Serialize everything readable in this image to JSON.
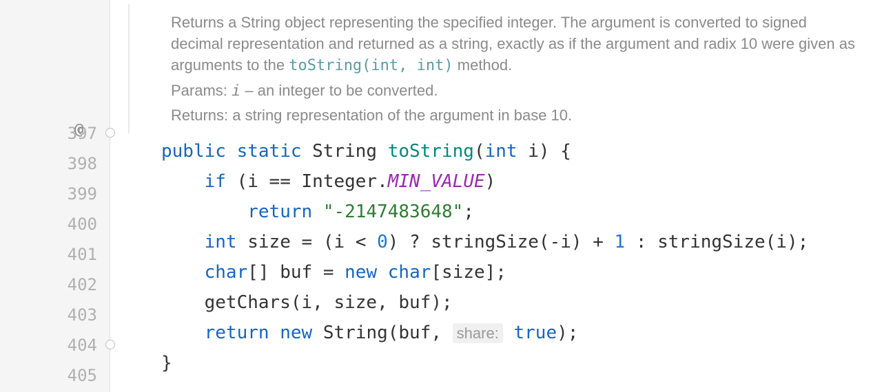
{
  "javadoc": {
    "desc_1": "Returns a String object representing the specified integer. The argument is converted to signed decimal representation and returned as a string, exactly as if the argument and radix 10 were given as arguments to the ",
    "desc_code": "toString(int, int)",
    "desc_2": " method.",
    "params_label": "Params:",
    "params_name": "i",
    "params_text": " – an integer to be converted.",
    "returns_label": "Returns:",
    "returns_text": " a string representation of the argument in base 10."
  },
  "gutter": {
    "lines": [
      "397",
      "398",
      "399",
      "400",
      "401",
      "402",
      "403",
      "404",
      "405"
    ],
    "annotation": "@"
  },
  "code": {
    "line397": {
      "kw_public": "public",
      "kw_static": "static",
      "type_string": "String",
      "method_name": "toString",
      "paren_open": "(",
      "kw_int": "int",
      "param_i": " i",
      "paren_close": ")",
      "brace": " {"
    },
    "line398": {
      "kw_if": "if",
      "expr": " (i == Integer.",
      "const": "MIN_VALUE",
      "close": ")"
    },
    "line399": {
      "kw_return": "return",
      "sp": " ",
      "str": "\"-2147483648\"",
      "semi": ";"
    },
    "line400": {
      "kw_int": "int",
      "var": " size = (i < ",
      "zero": "0",
      "q": ") ? ",
      "fn1": "stringSize",
      "a1": "(-i) + ",
      "one": "1",
      "colon": " : ",
      "fn2": "stringSize",
      "a2": "(i);"
    },
    "line401": {
      "kw_char": "char",
      "decl": "[] buf = ",
      "kw_new": "new",
      "sp": " ",
      "kw_char2": "char",
      "sz": "[size];"
    },
    "line402": {
      "fn": "getChars",
      "args": "(i, size, buf);"
    },
    "line403": {
      "kw_return": "return",
      "sp": " ",
      "kw_new": "new",
      "sp2": " ",
      "type": "String",
      "open": "(buf, ",
      "hint": "share:",
      "sp3": " ",
      "bool": "true",
      "close": ");"
    },
    "line404": {
      "brace": "}"
    }
  }
}
